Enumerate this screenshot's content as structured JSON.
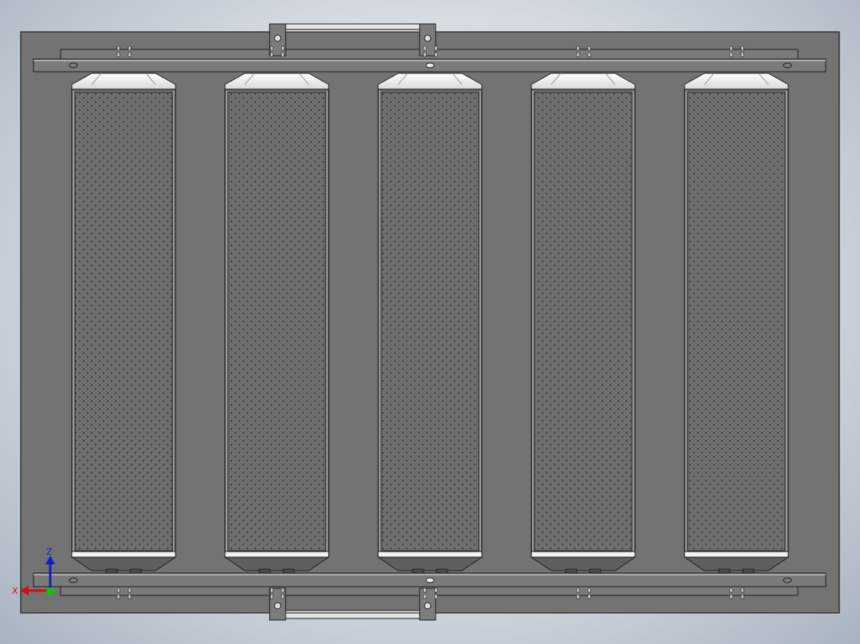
{
  "viewport": {
    "background": "#dfe3e9",
    "part_color": "#737373",
    "edge_color": "#1e1e1e",
    "highlight_color": "#ffffff"
  },
  "model": {
    "filter_count": 5,
    "filters": [
      {
        "label": ""
      },
      {
        "label": ""
      },
      {
        "label": ""
      },
      {
        "label": ""
      },
      {
        "label": ""
      }
    ],
    "handles": [
      "top-left",
      "top-right",
      "bottom-left",
      "bottom-right"
    ]
  },
  "triad": {
    "x_label": "X",
    "z_label": "Z",
    "x_color": "#d01010",
    "y_color": "#10c010",
    "z_color": "#1020c0"
  }
}
